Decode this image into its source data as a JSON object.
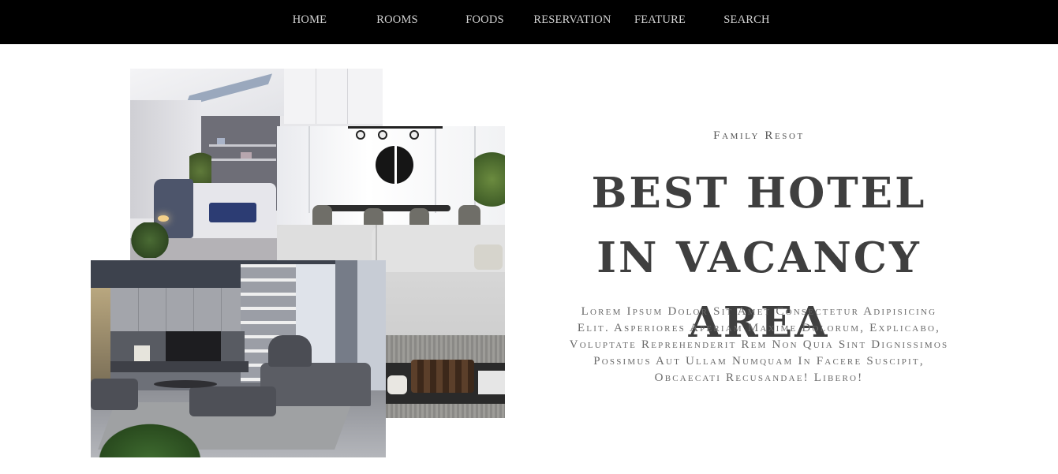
{
  "nav": {
    "items": [
      {
        "label": "HOME"
      },
      {
        "label": "ROOMS"
      },
      {
        "label": "FOODS"
      },
      {
        "label": "RESERVATION"
      },
      {
        "label": "FEATURE"
      },
      {
        "label": "SEARCH"
      }
    ]
  },
  "hero": {
    "subtitle": "Family Resot",
    "headline": "BEST HOTEL IN VACANCY AREA",
    "description": "Lorem Ipsum Dolor Sit Amet Consectetur Adipisicing Elit. Asperiores Aperiam Maxime Dolorum, Explicabo, Voluptate Reprehenderit Rem Non Quia Sint Dignissimos Possimus Aut Ullam Numquam In Facere Suscipit, Obcaecati Recusandae! Libero!"
  },
  "gallery": {
    "images": [
      {
        "name": "bedroom-photo"
      },
      {
        "name": "dining-room-photo"
      },
      {
        "name": "living-room-photo"
      }
    ]
  },
  "colors": {
    "nav_background": "#000000",
    "nav_text": "#d2d2d2",
    "headline": "#3f3f3f",
    "body_text": "#6a6a6a"
  }
}
